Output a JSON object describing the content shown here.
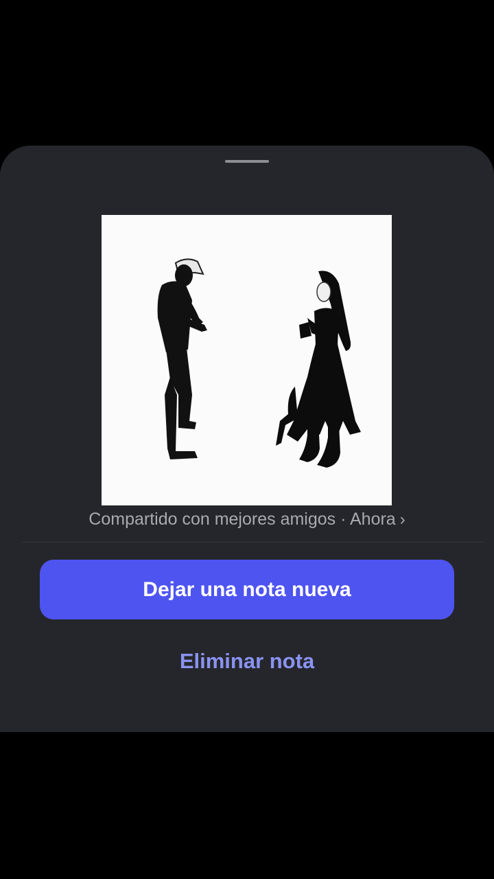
{
  "sheet": {
    "shared_text": "Compartido con mejores amigos · Ahora",
    "chevron": "›",
    "primary_button_label": "Dejar una nota nueva",
    "secondary_button_label": "Eliminar nota"
  },
  "artwork": {
    "description_icon": "photo-two-dancers"
  },
  "colors": {
    "background": "#000000",
    "sheet": "#25262b",
    "primary_button": "#4e54f0",
    "secondary_text": "#8a93f2",
    "meta_text": "#a9aab0"
  }
}
